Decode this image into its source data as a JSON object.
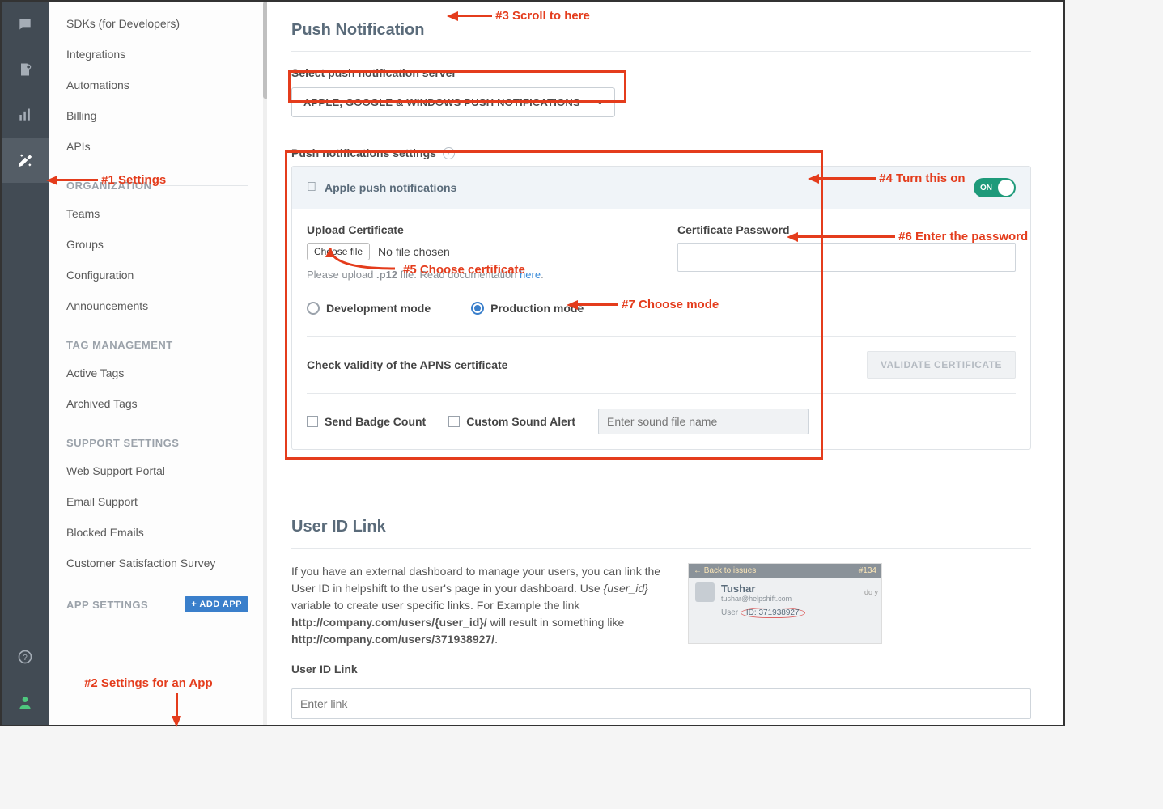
{
  "rail": {
    "chat": "chat",
    "docs": "docs",
    "analytics": "analytics",
    "settings": "settings",
    "help": "help",
    "profile": "profile"
  },
  "sidebar": {
    "items_top": [
      "SDKs (for Developers)",
      "Integrations",
      "Automations",
      "Billing",
      "APIs"
    ],
    "org_header": "ORGANIZATION",
    "org_items": [
      "Teams",
      "Groups",
      "Configuration",
      "Announcements"
    ],
    "tag_header": "TAG MANAGEMENT",
    "tag_items": [
      "Active Tags",
      "Archived Tags"
    ],
    "support_header": "SUPPORT SETTINGS",
    "support_items": [
      "Web Support Portal",
      "Email Support",
      "Blocked Emails",
      "Customer Satisfaction Survey"
    ],
    "app_header": "APP SETTINGS",
    "add_app": "+ ADD APP"
  },
  "push": {
    "title": "Push Notification",
    "select_label": "Select push notification server",
    "server_value": "APPLE, GOOGLE & WINDOWS PUSH NOTIFICATIONS",
    "settings_label": "Push notifications settings",
    "apple_header": "Apple push notifications",
    "toggle_text": "ON",
    "upload_label": "Upload Certificate",
    "choose_file": "Choose file",
    "no_file": "No file chosen",
    "hint_pre": "Please upload ",
    "hint_bold": ".p12",
    "hint_post": " file. Read documentation ",
    "hint_link": "here",
    "cert_pwd_label": "Certificate Password",
    "dev_mode": "Development mode",
    "prod_mode": "Production mode",
    "validate_label": "Check validity of the APNS certificate",
    "validate_btn": "VALIDATE CERTIFICATE",
    "badge_label": "Send Badge Count",
    "sound_label": "Custom Sound Alert",
    "sound_placeholder": "Enter sound file name"
  },
  "userid": {
    "title": "User ID Link",
    "desc_1": "If you have an external dashboard to manage your users, you can link the User ID in helpshift to the user's page in your dashboard. Use ",
    "desc_var": "{user_id}",
    "desc_2": " variable to create user specific links. For Example the link ",
    "desc_b1": "http://company.com/users/{user_id}/",
    "desc_3": " will result in something like ",
    "desc_b2": "http://company.com/users/371938927/",
    "preview_back": "← Back to issues",
    "preview_num": "#134",
    "preview_name": "Tushar",
    "preview_email": "tushar@helpshift.com",
    "preview_uid_label": "User",
    "preview_uid": "ID: 371938927",
    "preview_do": "do y",
    "link_label": "User ID Link",
    "link_placeholder": "Enter link"
  },
  "ann": {
    "a1": "#1 Settings",
    "a2": "#2 Settings for an App",
    "a3": "#3 Scroll to here",
    "a4": "#4 Turn this on",
    "a5": "#5 Choose certificate",
    "a6": "#6 Enter the password",
    "a7": "#7 Choose mode"
  }
}
